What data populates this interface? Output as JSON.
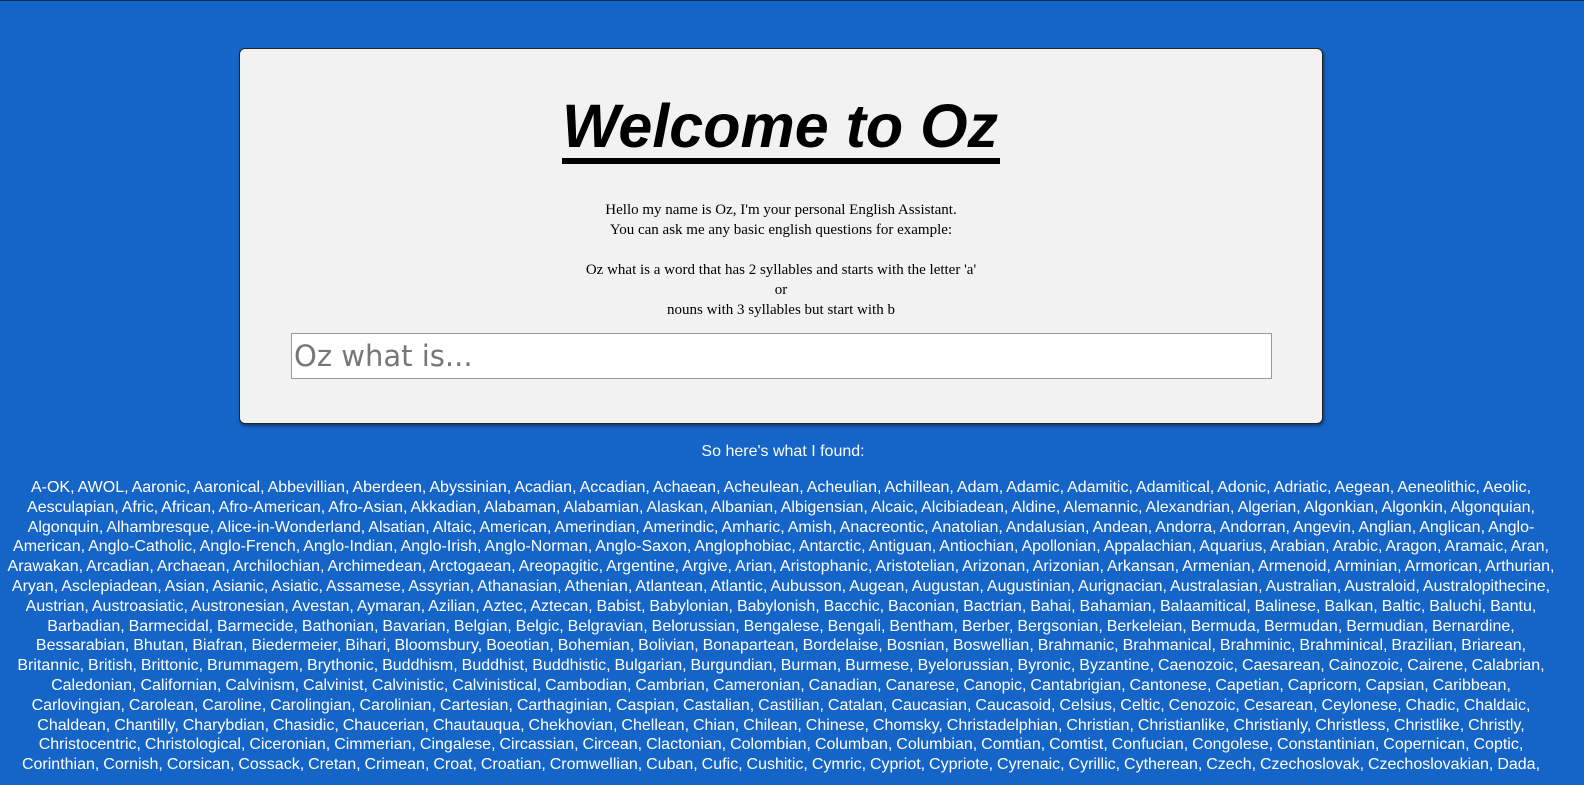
{
  "header": {
    "title": "Welcome to Oz"
  },
  "intro": {
    "line1": "Hello my name is Oz, I'm your personal English Assistant.",
    "line2": "You can ask me any basic english questions for example:",
    "example1": "Oz what is a word that has 2 syllables and starts with the letter 'a'",
    "or": "or",
    "example2": "nouns with 3 syllables but start with b"
  },
  "search": {
    "placeholder": "Oz what is...",
    "value": ""
  },
  "results": {
    "heading": "So here's what I found:",
    "words": "A-OK, AWOL, Aaronic, Aaronical, Abbevillian, Aberdeen, Abyssinian, Acadian, Accadian, Achaean, Acheulean, Acheulian, Achillean, Adam, Adamic, Adamitic, Adamitical, Adonic, Adriatic, Aegean, Aeneolithic, Aeolic, Aesculapian, Afric, African, Afro-American, Afro-Asian, Akkadian, Alabaman, Alabamian, Alaskan, Albanian, Albigensian, Alcaic, Alcibiadean, Aldine, Alemannic, Alexandrian, Algerian, Algonkian, Algonkin, Algonquian, Algonquin, Alhambresque, Alice-in-Wonderland, Alsatian, Altaic, American, Amerindian, Amerindic, Amharic, Amish, Anacreontic, Anatolian, Andalusian, Andean, Andorra, Andorran, Angevin, Anglian, Anglican, Anglo-American, Anglo-Catholic, Anglo-French, Anglo-Indian, Anglo-Irish, Anglo-Norman, Anglo-Saxon, Anglophobiac, Antarctic, Antiguan, Antiochian, Apollonian, Appalachian, Aquarius, Arabian, Arabic, Aragon, Aramaic, Aran, Arawakan, Arcadian, Archaean, Archilochian, Archimedean, Arctogaean, Areopagitic, Argentine, Argive, Arian, Aristophanic, Aristotelian, Arizonan, Arizonian, Arkansan, Armenian, Armenoid, Arminian, Armorican, Arthurian, Aryan, Asclepiadean, Asian, Asianic, Asiatic, Assamese, Assyrian, Athanasian, Athenian, Atlantean, Atlantic, Aubusson, Augean, Augustan, Augustinian, Aurignacian, Australasian, Australian, Australoid, Australopithecine, Austrian, Austroasiatic, Austronesian, Avestan, Aymaran, Azilian, Aztec, Aztecan, Babist, Babylonian, Babylonish, Bacchic, Baconian, Bactrian, Bahai, Bahamian, Balaamitical, Balinese, Balkan, Baltic, Baluchi, Bantu, Barbadian, Barmecidal, Barmecide, Bathonian, Bavarian, Belgian, Belgic, Belgravian, Belorussian, Bengalese, Bengali, Bentham, Berber, Bergsonian, Berkeleian, Bermuda, Bermudan, Bermudian, Bernardine, Bessarabian, Bhutan, Biafran, Biedermeier, Bihari, Bloomsbury, Boeotian, Bohemian, Bolivian, Bonapartean, Bordelaise, Bosnian, Boswellian, Brahmanic, Brahmanical, Brahminic, Brahminical, Brazilian, Briarean, Britannic, British, Brittonic, Brummagem, Brythonic, Buddhism, Buddhist, Buddhistic, Bulgarian, Burgundian, Burman, Burmese, Byelorussian, Byronic, Byzantine, Caenozoic, Caesarean, Cainozoic, Cairene, Calabrian, Caledonian, Californian, Calvinism, Calvinist, Calvinistic, Calvinistical, Cambodian, Cambrian, Cameronian, Canadian, Canarese, Canopic, Cantabrigian, Cantonese, Capetian, Capricorn, Capsian, Caribbean, Carlovingian, Carolean, Caroline, Carolingian, Carolinian, Cartesian, Carthaginian, Caspian, Castalian, Castilian, Catalan, Caucasian, Caucasoid, Celsius, Celtic, Cenozoic, Cesarean, Ceylonese, Chadic, Chaldaic, Chaldean, Chantilly, Charybdian, Chasidic, Chaucerian, Chautauqua, Chekhovian, Chellean, Chian, Chilean, Chinese, Chomsky, Christadelphian, Christian, Christianlike, Christianly, Christless, Christlike, Christly, Christocentric, Christological, Ciceronian, Cimmerian, Cingalese, Circassian, Circean, Clactonian, Colombian, Columban, Columbian, Comtian, Comtist, Confucian, Congolese, Constantinian, Copernican, Coptic, Corinthian, Cornish, Corsican, Cossack, Cretan, Crimean, Croat, Croatian, Cromwellian, Cuban, Cufic, Cushitic, Cymric, Cypriot, Cypriote, Cyrenaic, Cyrillic, Cytherean, Czech, Czechoslovak, Czechoslovakian, Dada,"
  }
}
